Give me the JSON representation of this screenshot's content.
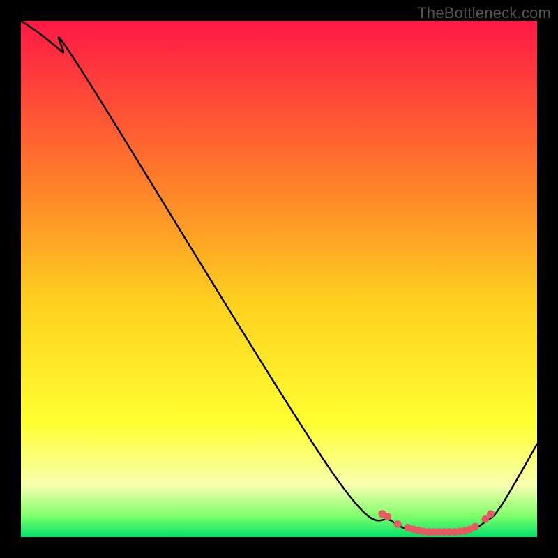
{
  "watermark": "TheBottleneck.com",
  "colors": {
    "black": "#000000",
    "curve": "#000000",
    "marker": "#e85a62",
    "grad_top": "#ff1846",
    "grad_mid1": "#ff7a2a",
    "grad_mid2": "#ffd21f",
    "grad_yellow": "#ffff30",
    "grad_ltyellow": "#f8ffb0",
    "grad_green1": "#7dff6a",
    "grad_green2": "#00e26b"
  },
  "chart_data": {
    "type": "line",
    "title": "",
    "xlabel": "",
    "ylabel": "",
    "xlim": [
      0,
      100
    ],
    "ylim": [
      0,
      100
    ],
    "curve": {
      "x": [
        0,
        3,
        8,
        12,
        60,
        72,
        78,
        86,
        90,
        93,
        100
      ],
      "y": [
        100,
        98,
        94,
        90,
        13,
        3,
        1,
        1,
        3,
        6,
        18
      ]
    },
    "markers": {
      "x": [
        70,
        71,
        73,
        75,
        76,
        77,
        78,
        79,
        80,
        81,
        82,
        83,
        84,
        85,
        86,
        87,
        88,
        90,
        91
      ],
      "y": [
        4.5,
        4,
        2.5,
        1.8,
        1.5,
        1.3,
        1.1,
        1.0,
        1.0,
        1.0,
        1.0,
        1.0,
        1.0,
        1.1,
        1.2,
        1.5,
        2.0,
        3.5,
        4.5
      ]
    }
  }
}
